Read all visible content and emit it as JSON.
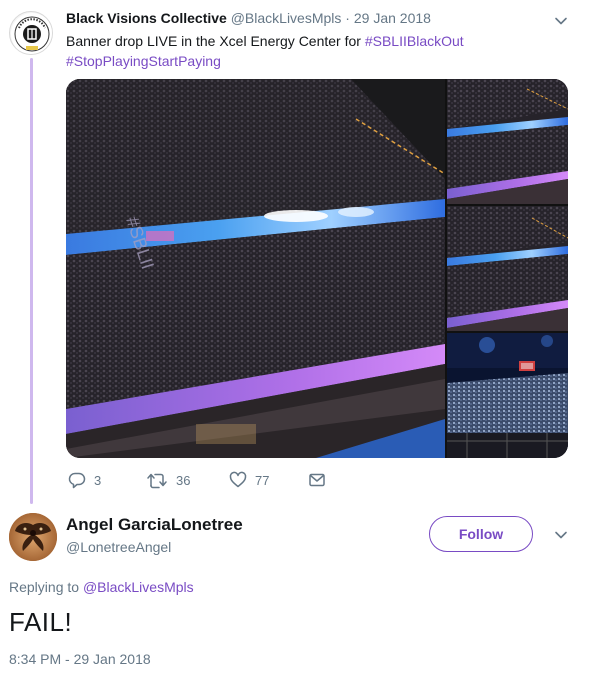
{
  "tweet1": {
    "author_name": "Black Visions Collective",
    "handle": "@BlackLivesMpls",
    "separator": "·",
    "date": "29 Jan 2018",
    "text_line1_prefix": "Banner drop LIVE in the Xcel Energy Center for ",
    "hashtag1": "#SBLIIBlackOut",
    "hashtag2": "#StopPlayingStartPaying",
    "image_banner_text": "#SBLII",
    "actions": {
      "reply_count": "3",
      "retweet_count": "36",
      "like_count": "77"
    }
  },
  "tweet2": {
    "author_name": "Angel GarciaLonetree",
    "handle": "@LonetreeAngel",
    "follow_label": "Follow",
    "replying_prefix": "Replying to ",
    "replying_to": "@BlackLivesMpls",
    "text": "FAIL!",
    "timestamp": "8:34 PM - 29 Jan 2018"
  },
  "colors": {
    "accent": "#794bc4",
    "secondary_text": "#657786",
    "primary_text": "#14171a",
    "thread_line": "#cfb8ee"
  },
  "icons": [
    "more-caret-icon",
    "reply-icon",
    "retweet-icon",
    "like-icon",
    "message-icon"
  ]
}
